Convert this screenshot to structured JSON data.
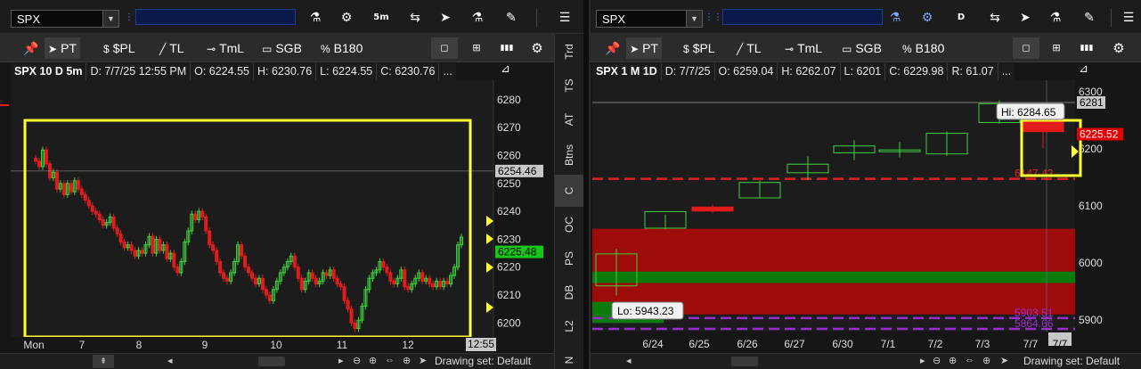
{
  "left": {
    "symbol": "SPX",
    "aggregation_label": "5m",
    "header": {
      "symbol": "SPX 10 D 5m",
      "date": "D: 7/7/25 12:55 PM",
      "open": "O: 6224.55",
      "high": "H: 6230.76",
      "low": "L: 6224.55",
      "close": "C: 6230.76",
      "more": "..."
    },
    "drawing_set": "Drawing set: Default",
    "time_marker": "12:55"
  },
  "right": {
    "symbol": "SPX",
    "aggregation_label": "D",
    "header": {
      "symbol": "SPX 1 M 1D",
      "date": "D: 7/7/25",
      "open": "O: 6259.04",
      "high": "H: 6262.07",
      "low": "L: 6201",
      "close": "C: 6229.98",
      "range": "R: 61.07",
      "more": "..."
    },
    "drawing_set": "Drawing set: Default",
    "time_marker": "7/7"
  },
  "drawing_tools": {
    "pin": "📌",
    "pointer": "PT",
    "price_level": "$PL",
    "trendline": "TL",
    "timeline": "TmL",
    "sgb": "SGB",
    "b180": "B180"
  },
  "side_tabs": [
    "Trd",
    "TS",
    "AT",
    "Btns",
    "C",
    "OC",
    "PS",
    "DB",
    "L2",
    "N"
  ],
  "side_tab_active": "C",
  "colors": {
    "up": "#3fd13f",
    "down": "#e31b1b",
    "highlight": "#ffff33",
    "price_tag_green": "#17c617",
    "price_tag_red": "#e00000",
    "support_red": "#e02020",
    "purple": "#9b2ccf",
    "band_red": "#9e0b0b",
    "band_green": "#0c7a0c"
  },
  "chart_data": [
    {
      "type": "candlestick",
      "symbol": "SPX",
      "timeframe": "10 D 5m",
      "ylim": [
        6195,
        6287
      ],
      "y_ticks": [
        6200,
        6210,
        6220,
        6230,
        6240,
        6250,
        6260,
        6270,
        6280
      ],
      "x_tick_labels": [
        "Mon",
        "7",
        "8",
        "9",
        "10",
        "11",
        "12"
      ],
      "price_tags": [
        {
          "label": "6254.46",
          "value": 6254.46,
          "style": "grey"
        },
        {
          "label": "6225.48",
          "value": 6225.48,
          "style": "green"
        }
      ],
      "closes": [
        6258,
        6256,
        6262,
        6257,
        6252,
        6254,
        6248,
        6250,
        6246,
        6250,
        6247,
        6251,
        6248,
        6246,
        6244,
        6242,
        6240,
        6239,
        6237,
        6235,
        6236,
        6238,
        6234,
        6232,
        6229,
        6227,
        6228,
        6226,
        6224,
        6226,
        6225,
        6228,
        6231,
        6225,
        6230,
        6226,
        6228,
        6223,
        6225,
        6220,
        6218,
        6222,
        6229,
        6233,
        6239,
        6237,
        6240,
        6238,
        6233,
        6228,
        6226,
        6222,
        6218,
        6216,
        6215,
        6218,
        6222,
        6228,
        6224,
        6220,
        6218,
        6216,
        6214,
        6216,
        6212,
        6210,
        6208,
        6212,
        6215,
        6218,
        6220,
        6222,
        6224,
        6220,
        6216,
        6212,
        6215,
        6218,
        6216,
        6214,
        6215,
        6218,
        6217,
        6219,
        6216,
        6214,
        6213,
        6208,
        6205,
        6200,
        6198,
        6201,
        6206,
        6212,
        6216,
        6218,
        6219,
        6222,
        6220,
        6218,
        6215,
        6214,
        6216,
        6219,
        6213,
        6212,
        6214,
        6216,
        6218,
        6215,
        6216,
        6214,
        6213,
        6215,
        6213,
        6215,
        6214,
        6217,
        6220,
        6228,
        6230.76
      ]
    },
    {
      "type": "candlestick",
      "symbol": "SPX",
      "timeframe": "1 M 1D",
      "ylim": [
        5880,
        6320
      ],
      "y_ticks": [
        5900,
        6000,
        6100,
        6200,
        6300
      ],
      "x_tick_labels": [
        "6/24",
        "6/25",
        "6/26",
        "6/27",
        "6/30",
        "7/1",
        "7/2",
        "7/3",
        "7/7"
      ],
      "candles": [
        {
          "date": "6/23",
          "open": 5960,
          "high": 6025,
          "low": 5943.23,
          "close": 6016
        },
        {
          "date": "6/24",
          "open": 6061,
          "high": 6085,
          "low": 6059,
          "close": 6090
        },
        {
          "date": "6/25",
          "open": 6098,
          "high": 6103,
          "low": 6088,
          "close": 6091
        },
        {
          "date": "6/26",
          "open": 6114,
          "high": 6144,
          "low": 6113,
          "close": 6141
        },
        {
          "date": "6/27",
          "open": 6158,
          "high": 6187,
          "low": 6145,
          "close": 6173
        },
        {
          "date": "6/30",
          "open": 6193,
          "high": 6215,
          "low": 6180,
          "close": 6205
        },
        {
          "date": "7/1",
          "open": 6197,
          "high": 6212,
          "low": 6185,
          "close": 6198
        },
        {
          "date": "7/2",
          "open": 6191,
          "high": 6230,
          "low": 6188,
          "close": 6227
        },
        {
          "date": "7/3",
          "open": 6246,
          "high": 6284.65,
          "low": 6244,
          "close": 6279
        },
        {
          "date": "7/7",
          "open": 6259.04,
          "high": 6262.07,
          "low": 6201,
          "close": 6229.98
        }
      ],
      "annotations": {
        "hi": "Hi: 6284.65",
        "lo": "Lo: 5943.23"
      },
      "price_tags": [
        {
          "label": "6281",
          "value": 6281,
          "style": "grey"
        },
        {
          "label": "6225.52",
          "value": 6225.52,
          "style": "red"
        }
      ],
      "levels": [
        {
          "label": "6147.43",
          "value": 6147.43,
          "color": "red"
        },
        {
          "label": "5903.51",
          "value": 5903.51,
          "color": "purple"
        },
        {
          "label": "5864.66",
          "value": 5864.66,
          "color": "purple"
        }
      ],
      "reference_line": 6281
    }
  ]
}
